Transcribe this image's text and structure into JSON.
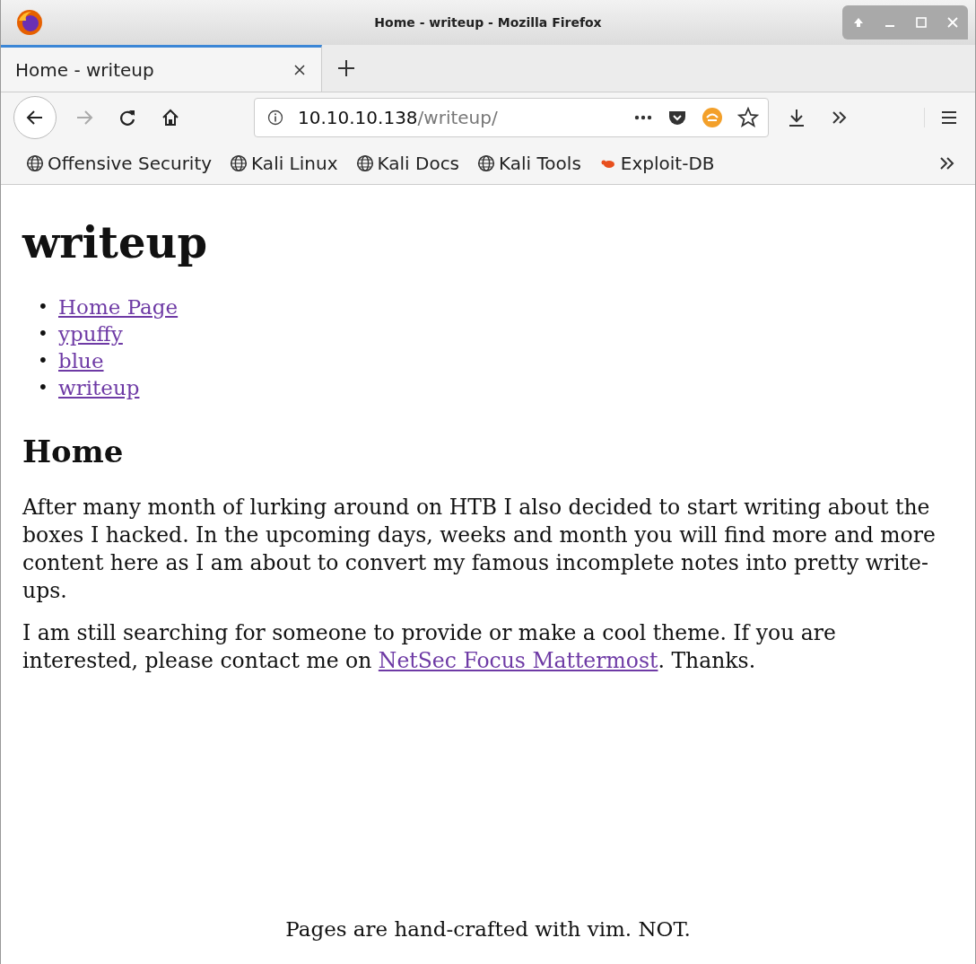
{
  "window": {
    "title": "Home - writeup - Mozilla Firefox"
  },
  "tabs": [
    {
      "label": "Home - writeup",
      "selected": true
    }
  ],
  "address_bar": {
    "host": "10.10.10.138",
    "path": "/writeup/"
  },
  "bookmarks": [
    {
      "label": "Offensive Security",
      "kind": "globe"
    },
    {
      "label": "Kali Linux",
      "kind": "globe"
    },
    {
      "label": "Kali Docs",
      "kind": "globe"
    },
    {
      "label": "Kali Tools",
      "kind": "globe"
    },
    {
      "label": "Exploit-DB",
      "kind": "bug"
    }
  ],
  "page": {
    "heading": "writeup",
    "nav": [
      {
        "bullet": "•",
        "label": "Home Page",
        "visited": true
      },
      {
        "bullet": "•",
        "label": "ypuffy",
        "visited": true
      },
      {
        "bullet": "•",
        "label": "blue",
        "visited": true
      },
      {
        "bullet": "•",
        "label": "writeup",
        "visited": true
      }
    ],
    "section_heading": "Home",
    "paragraphs": [
      [
        {
          "kind": "text",
          "text": "After many month of lurking around on HTB I also decided to start writing about the boxes I hacked. In the upcoming days, weeks and month you will find more and more content here as I am about to convert my famous incomplete notes into pretty write-ups."
        }
      ],
      [
        {
          "kind": "text",
          "text": "I am still searching for someone to provide or make a cool theme. If you are interested, please contact me on "
        },
        {
          "kind": "link",
          "text": "NetSec Focus Mattermost"
        },
        {
          "kind": "text",
          "text": ". Thanks."
        }
      ]
    ],
    "footer": "Pages are hand-crafted with vim. NOT."
  }
}
